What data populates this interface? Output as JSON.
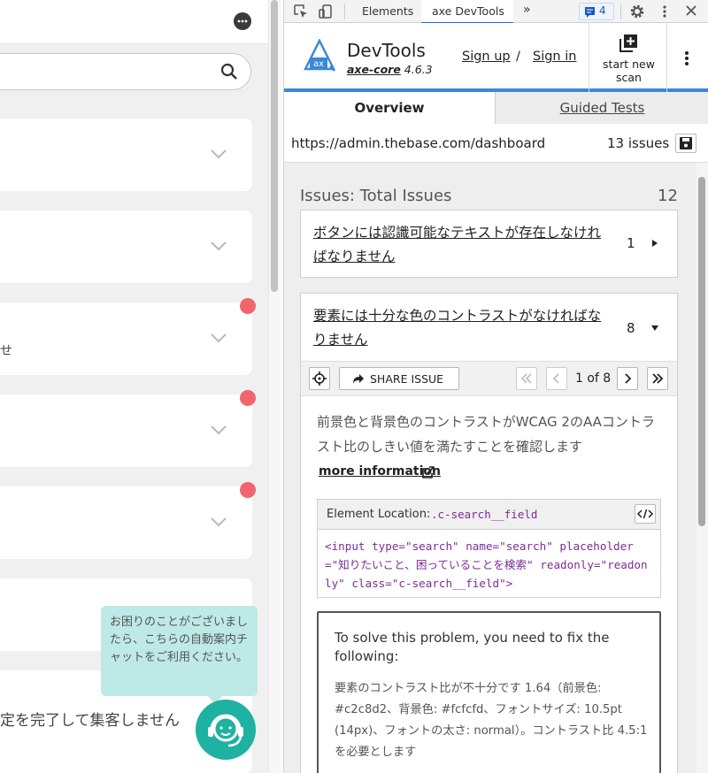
{
  "website": {
    "tooltip_text": "お困りのことがございましたら、こちらの自動案内チャットをご利用ください。",
    "bottom_text": "定を完了して集客しません",
    "card_fragment": "せ"
  },
  "devtools": {
    "tabs": [
      "Elements",
      "axe DevTools"
    ],
    "more_tabs": "»",
    "message_count": "4"
  },
  "axe": {
    "title": "DevTools",
    "version_prefix": "axe-core",
    "version": "4.6.3",
    "sign_up": "Sign up",
    "sign_in": "Sign in",
    "slash": "/",
    "scan_line1": "start new",
    "scan_line2": "scan",
    "nav_overview": "Overview",
    "nav_guided": "Guided Tests",
    "url": "https://admin.thebase.com/dashboard",
    "issues_count": "13 issues",
    "total_label": "Issues: Total Issues",
    "total_count": "12",
    "issues": [
      {
        "title": "ボタンには認識可能なテキストが存在しなければなりません",
        "count": "1"
      },
      {
        "title": "要素には十分な色のコントラストがなければなりません",
        "count": "8"
      }
    ],
    "share_label": "SHARE ISSUE",
    "pagination": "1 of 8",
    "description": "前景色と背景色のコントラストがWCAG 2のAAコントラスト比のしきい値を満たすことを確認します",
    "more_information": "more information",
    "element_location_label": "Element Location:",
    "element_selector": ".c-search__field",
    "code_snippet": "<input type=\"search\" name=\"search\" placeholder=\"知りたいこと、困っていることを検索\" readonly=\"readonly\" class=\"c-search__field\">",
    "fix_title": "To solve this problem, you need to fix the following:",
    "fix_body": "要素のコントラスト比が不十分です 1.64（前景色: #c2c8d2、背景色: #fcfcfd、フォントサイズ: 10.5pt (14px)、フォントの太さ: normal）。コントラスト比 4.5:1を必要とします"
  },
  "colors": {
    "accent_blue": "#3b88d8",
    "notification_dot": "#f2656f",
    "chat_teal": "#1fb1a2",
    "tooltip_bg": "#bde9e6",
    "selector_purple": "#7b2c96"
  }
}
